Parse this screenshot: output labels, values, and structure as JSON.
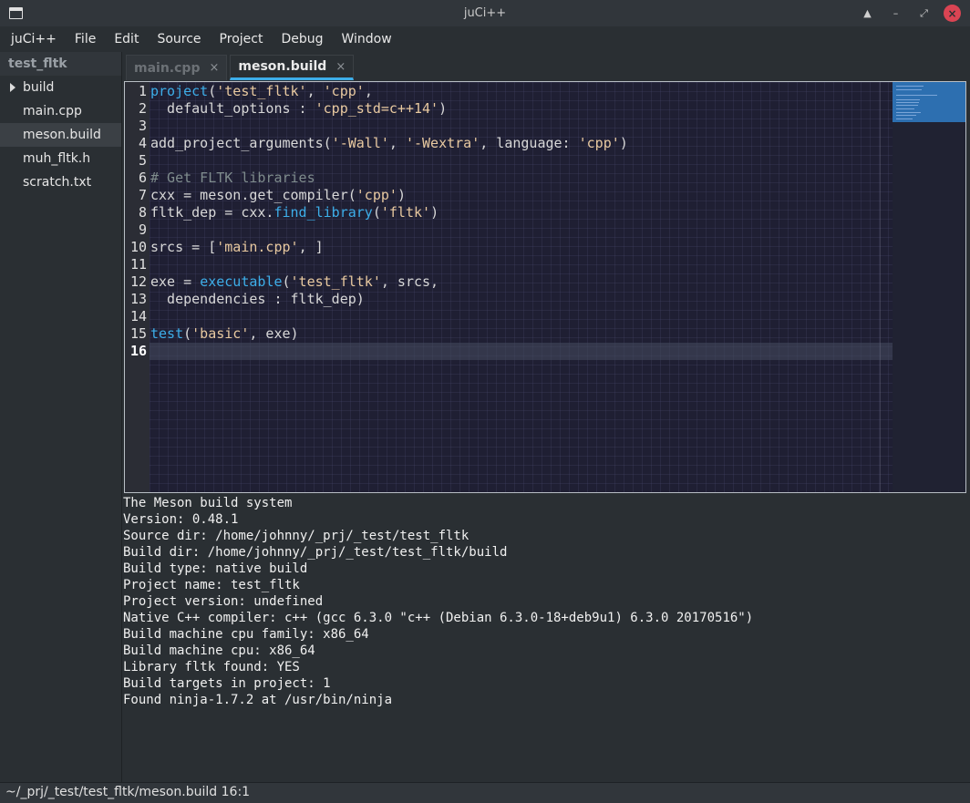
{
  "window": {
    "title": "juCi++"
  },
  "menu": [
    "juCi++",
    "File",
    "Edit",
    "Source",
    "Project",
    "Debug",
    "Window"
  ],
  "sidebar": {
    "project": "test_fltk",
    "items": [
      {
        "label": "build",
        "folder": true
      },
      {
        "label": "main.cpp"
      },
      {
        "label": "meson.build",
        "selected": true
      },
      {
        "label": "muh_fltk.h"
      },
      {
        "label": "scratch.txt"
      }
    ]
  },
  "tabs": [
    {
      "label": "main.cpp",
      "close": "×",
      "active": false
    },
    {
      "label": "meson.build",
      "close": "×",
      "active": true
    }
  ],
  "editor": {
    "current_line": 16,
    "lines": [
      [
        {
          "t": "project",
          "c": "fn"
        },
        {
          "t": "("
        },
        {
          "t": "'test_fltk'",
          "c": "str"
        },
        {
          "t": ", "
        },
        {
          "t": "'cpp'",
          "c": "str"
        },
        {
          "t": ","
        }
      ],
      [
        {
          "t": "  default_options : "
        },
        {
          "t": "'cpp_std=c++14'",
          "c": "str"
        },
        {
          "t": ")"
        }
      ],
      [],
      [
        {
          "t": "add_project_arguments("
        },
        {
          "t": "'-Wall'",
          "c": "str"
        },
        {
          "t": ", "
        },
        {
          "t": "'-Wextra'",
          "c": "str"
        },
        {
          "t": ", language: "
        },
        {
          "t": "'cpp'",
          "c": "str"
        },
        {
          "t": ")"
        }
      ],
      [],
      [
        {
          "t": "# Get FLTK libraries",
          "c": "cm"
        }
      ],
      [
        {
          "t": "cxx = meson.get_compiler("
        },
        {
          "t": "'cpp'",
          "c": "str"
        },
        {
          "t": ")"
        }
      ],
      [
        {
          "t": "fltk_dep = cxx."
        },
        {
          "t": "find_library",
          "c": "fn"
        },
        {
          "t": "("
        },
        {
          "t": "'fltk'",
          "c": "str"
        },
        {
          "t": ")"
        }
      ],
      [],
      [
        {
          "t": "srcs = ["
        },
        {
          "t": "'main.cpp'",
          "c": "str"
        },
        {
          "t": ", ]"
        }
      ],
      [],
      [
        {
          "t": "exe = "
        },
        {
          "t": "executable",
          "c": "fn"
        },
        {
          "t": "("
        },
        {
          "t": "'test_fltk'",
          "c": "str"
        },
        {
          "t": ", srcs,"
        }
      ],
      [
        {
          "t": "  dependencies : fltk_dep)"
        }
      ],
      [],
      [
        {
          "t": "test",
          "c": "fn"
        },
        {
          "t": "("
        },
        {
          "t": "'basic'",
          "c": "str"
        },
        {
          "t": ", exe)"
        }
      ],
      []
    ]
  },
  "terminal": [
    "The Meson build system",
    "Version: 0.48.1",
    "Source dir: /home/johnny/_prj/_test/test_fltk",
    "Build dir: /home/johnny/_prj/_test/test_fltk/build",
    "Build type: native build",
    "Project name: test_fltk",
    "Project version: undefined",
    "Native C++ compiler: c++ (gcc 6.3.0 \"c++ (Debian 6.3.0-18+deb9u1) 6.3.0 20170516\")",
    "Build machine cpu family: x86_64",
    "Build machine cpu: x86_64",
    "Library fltk found: YES",
    "Build targets in project: 1",
    "Found ninja-1.7.2 at /usr/bin/ninja"
  ],
  "status": "~/_prj/_test/test_fltk/meson.build 16:1",
  "colors": {
    "accent": "#3daee9",
    "close": "#da4453"
  },
  "icons": {
    "app": "window-icon",
    "keep_above": "keep-above-icon",
    "minimize": "minimize-icon",
    "maximize": "maximize-icon",
    "close": "close-icon",
    "folder_arrow": "expand-arrow-icon"
  }
}
